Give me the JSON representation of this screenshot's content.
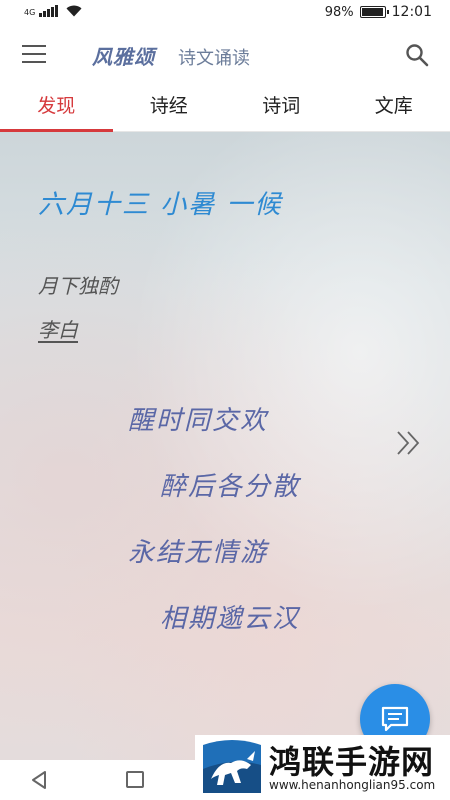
{
  "status_bar": {
    "network": "4G",
    "battery_text": "98%",
    "battery_level": 0.98,
    "time": "12:01",
    "icons": [
      "signal-icon",
      "wifi-icon",
      "battery-icon"
    ]
  },
  "app_bar": {
    "brand": "风雅颂",
    "subtitle": "诗文诵读",
    "icons": [
      "menu-icon",
      "search-icon"
    ]
  },
  "tabs": [
    {
      "label": "发现",
      "active": true
    },
    {
      "label": "诗经",
      "active": false
    },
    {
      "label": "诗词",
      "active": false
    },
    {
      "label": "文库",
      "active": false
    }
  ],
  "content": {
    "date_line": "六月十三  小暑  一候",
    "poem": {
      "title": "月下独酌",
      "author": "李白",
      "verses": [
        "醒时同交欢",
        "醉后各分散",
        "永结无情游",
        "相期邈云汉"
      ]
    },
    "accent_color": "#2e8ad2",
    "verse_color": "#5a67a6",
    "tab_active_color": "#d6393c",
    "icons": [
      "double-chevron-right-icon",
      "chat-icon"
    ]
  },
  "nav_bar": {
    "icons": [
      "back-icon",
      "recent-apps-icon"
    ]
  },
  "watermark": {
    "title": "鸿联手游网",
    "url": "www.henanhonglian95.com"
  }
}
